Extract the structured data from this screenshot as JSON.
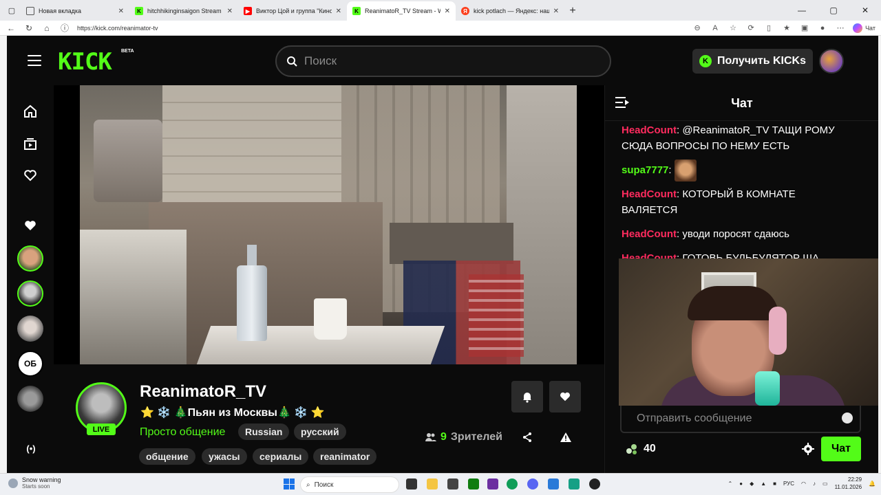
{
  "browser": {
    "tabs": [
      {
        "title": "Новая вкладка",
        "favicon": "new-tab-icon",
        "active": false
      },
      {
        "title": "hitchhikinginsaigon Stream - Wat",
        "favicon": "kick-icon",
        "active": false
      },
      {
        "title": "Виктор Цой и группа \"Кино\" - K",
        "favicon": "youtube-icon",
        "active": false
      },
      {
        "title": "ReanimatoR_TV Stream - Watch L",
        "favicon": "kick-icon",
        "active": true
      },
      {
        "title": "kick potlach — Яндекс: нашлось",
        "favicon": "yandex-icon",
        "active": false
      }
    ],
    "url": "https://kick.com/reanimator-tv",
    "chat_label": "Чат"
  },
  "kick": {
    "logo": "KICK",
    "beta": "BETA",
    "search_placeholder": "Поиск",
    "get_kicks": "Получить KICKs"
  },
  "channel": {
    "name": "ReanimatoR_TV",
    "live": "LIVE",
    "title": "⭐ ❄️ 🎄Пьян из Москвы🎄 ❄️ ⭐",
    "category": "Просто общение",
    "tags_row1": [
      "Russian",
      "русский"
    ],
    "tags_row2": [
      "общение",
      "ужасы",
      "сериалы",
      "reanimator"
    ],
    "viewers_count": "9",
    "viewers_label": "Зрителей"
  },
  "sidebar": {
    "live_label": "(•)"
  },
  "chat": {
    "title": "Чат",
    "messages": [
      {
        "user": "HeadCount",
        "color": "#ff2b5e",
        "text": ": @ReanimatoR_TV ТАЩИ РОМУ СЮДА ВОПРОСЫ ПО НЕМУ ЕСТЬ"
      },
      {
        "user": "supa7777",
        "color": "#53fc18",
        "text": ":"
      },
      {
        "user": "HeadCount",
        "color": "#ff2b5e",
        "text": ": КОТОРЫЙ В КОМНАТЕ ВАЛЯЕТСЯ"
      },
      {
        "user": "HeadCount",
        "color": "#ff2b5e",
        "text": ": уводи поросят сдаюсь"
      },
      {
        "user": "HeadCount",
        "color": "#ff2b5e",
        "text": ": ГОТОВЬ БУЛЬБУЛЯТОР ША"
      }
    ],
    "input_placeholder": "Отправить сообщение",
    "points": "40",
    "send_label": "Чат"
  },
  "taskbar": {
    "weather_title": "Snow warning",
    "weather_sub": "Starts soon",
    "search_label": "Поиск",
    "lang": "РУС",
    "time": "22:29",
    "date": "11.01.2026"
  },
  "colors": {
    "kick_green": "#53fc18",
    "bg": "#0b0b0b",
    "chat_user_red": "#ff2b5e"
  }
}
